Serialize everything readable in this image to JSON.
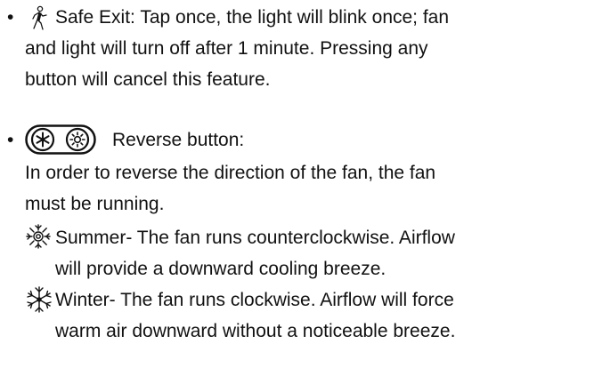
{
  "safe_exit": {
    "icon": "walking-person-icon",
    "lines": [
      "Safe Exit: Tap once, the light will blink once; fan",
      "and light will turn off after 1 minute. Pressing any",
      "button will cancel this feature."
    ]
  },
  "reverse": {
    "icons": [
      "winter-snowflake-icon",
      "summer-sun-icon"
    ],
    "title": "Reverse button:",
    "desc_lines": [
      "In order to reverse the direction of the fan, the fan",
      "must be running."
    ]
  },
  "summer": {
    "icon": "summer-sun-icon",
    "lines": [
      "Summer- The fan runs counterclockwise. Airflow",
      "will provide a downward cooling breeze."
    ]
  },
  "winter": {
    "icon": "winter-snowflake-icon",
    "lines": [
      "Winter- The fan runs clockwise. Airflow will force",
      "warm air downward without a noticeable breeze."
    ]
  }
}
